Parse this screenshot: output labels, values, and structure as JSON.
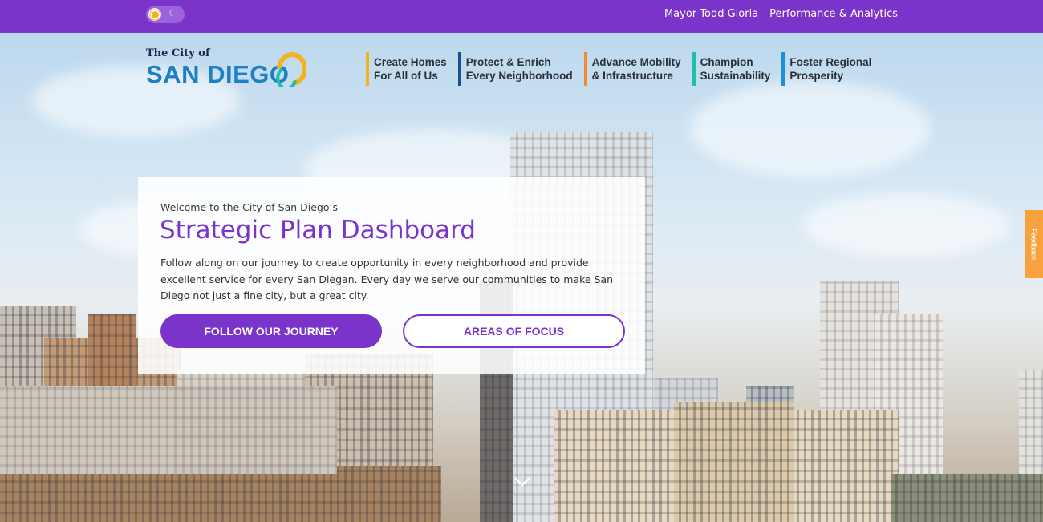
{
  "topbar": {
    "links": [
      "Mayor Todd Gloria",
      "Performance & Analytics"
    ]
  },
  "logo": {
    "small": "The City of",
    "big": "SAN DIEGO"
  },
  "nav": [
    {
      "label": "Create Homes\nFor All of Us",
      "color": "#f5b21f"
    },
    {
      "label": "Protect & Enrich\nEvery Neighborhood",
      "color": "#1c4f8f"
    },
    {
      "label": "Advance Mobility\n& Infrastructure",
      "color": "#f28b2a"
    },
    {
      "label": "Champion\nSustainability",
      "color": "#1fbfae"
    },
    {
      "label": "Foster Regional\nProsperity",
      "color": "#1e8fd6"
    }
  ],
  "hero": {
    "eyebrow": "Welcome to the City of San Diego’s",
    "title": "Strategic Plan Dashboard",
    "description": "Follow along on our journey to create opportunity in every neighborhood and provide excellent service for every San Diegan. Every day we serve our communities to make San Diego not just a fine city, but a great city.",
    "primary_button": "FOLLOW OUR JOURNEY",
    "secondary_button": "AREAS OF FOCUS"
  },
  "feedback": "Feedback",
  "colors": {
    "brand_purple": "#7a34c9",
    "feedback_orange": "#f7a23c"
  }
}
